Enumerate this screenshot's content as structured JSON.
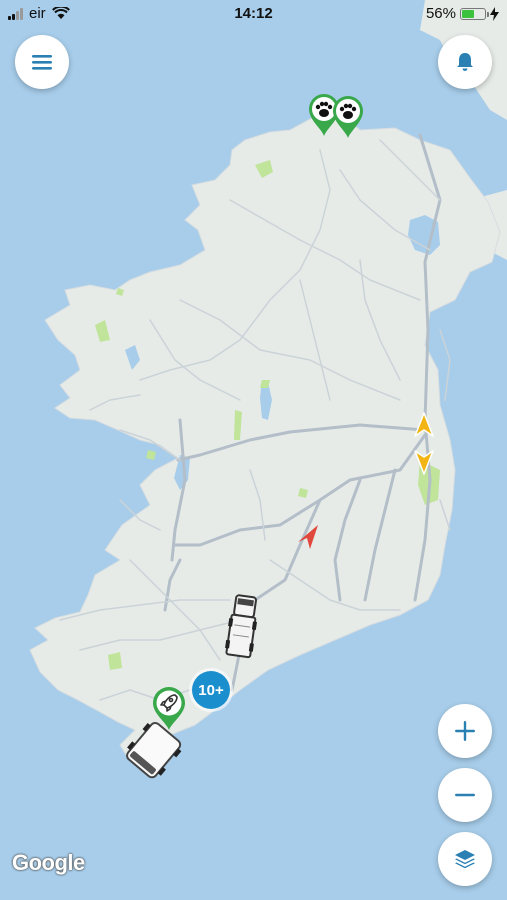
{
  "status_bar": {
    "carrier": "eir",
    "time": "14:12",
    "battery_percent": "56%",
    "battery_level": 0.56,
    "signal_bars": 2,
    "icons": [
      "signal-icon",
      "wifi-icon",
      "battery-icon",
      "charging-icon"
    ]
  },
  "controls": {
    "menu_icon": "hamburger-menu-icon",
    "notifications_icon": "bell-icon",
    "zoom_in_icon": "plus-icon",
    "zoom_out_icon": "minus-icon",
    "layers_icon": "layers-icon"
  },
  "map": {
    "cluster_count": "10+",
    "attribution": "Google",
    "markers": [
      "paw-marker",
      "paw-marker",
      "rocket-marker",
      "yellow-arrow-north",
      "yellow-arrow-south",
      "red-location-arrow",
      "truck-vehicle",
      "van-vehicle"
    ],
    "colors": {
      "sea": "#a7cdea",
      "land": "#e6ebe8",
      "roads": "#b7c3cc",
      "parks": "#bfe49a",
      "accent": "#2a7fb3",
      "marker_green": "#38a84a",
      "cluster_blue": "#1b8fce"
    }
  }
}
